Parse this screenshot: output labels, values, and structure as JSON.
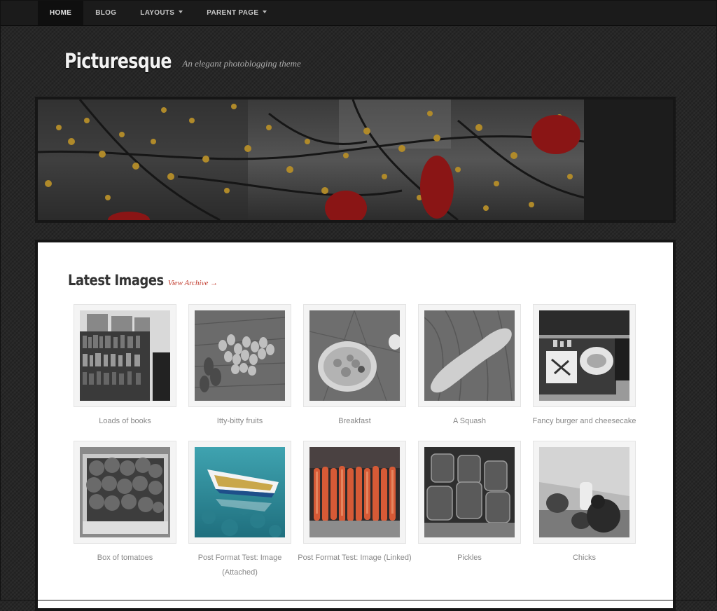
{
  "nav": {
    "items": [
      {
        "label": "HOME",
        "active": true,
        "dropdown": false
      },
      {
        "label": "BLOG",
        "active": false,
        "dropdown": false
      },
      {
        "label": "LAYOUTS",
        "active": false,
        "dropdown": true
      },
      {
        "label": "PARENT PAGE",
        "active": false,
        "dropdown": true
      }
    ]
  },
  "header": {
    "title": "Picturesque",
    "description": "An elegant photoblogging theme"
  },
  "latest": {
    "title": "Latest Images",
    "archive_link": "View Archive →",
    "items": [
      {
        "caption": "Loads of books"
      },
      {
        "caption": "Itty-bitty fruits"
      },
      {
        "caption": "Breakfast"
      },
      {
        "caption": "A Squash"
      },
      {
        "caption": "Fancy burger and cheesecake"
      },
      {
        "caption": "Box of tomatoes"
      },
      {
        "caption": "Post Format Test: Image (Attached)"
      },
      {
        "caption": "Post Format Test: Image (Linked)"
      },
      {
        "caption": "Pickles"
      },
      {
        "caption": "Chicks"
      }
    ]
  },
  "colors": {
    "accent": "#c0392b",
    "page_bg": "#272727",
    "nav_bg": "#1b1b1b"
  }
}
